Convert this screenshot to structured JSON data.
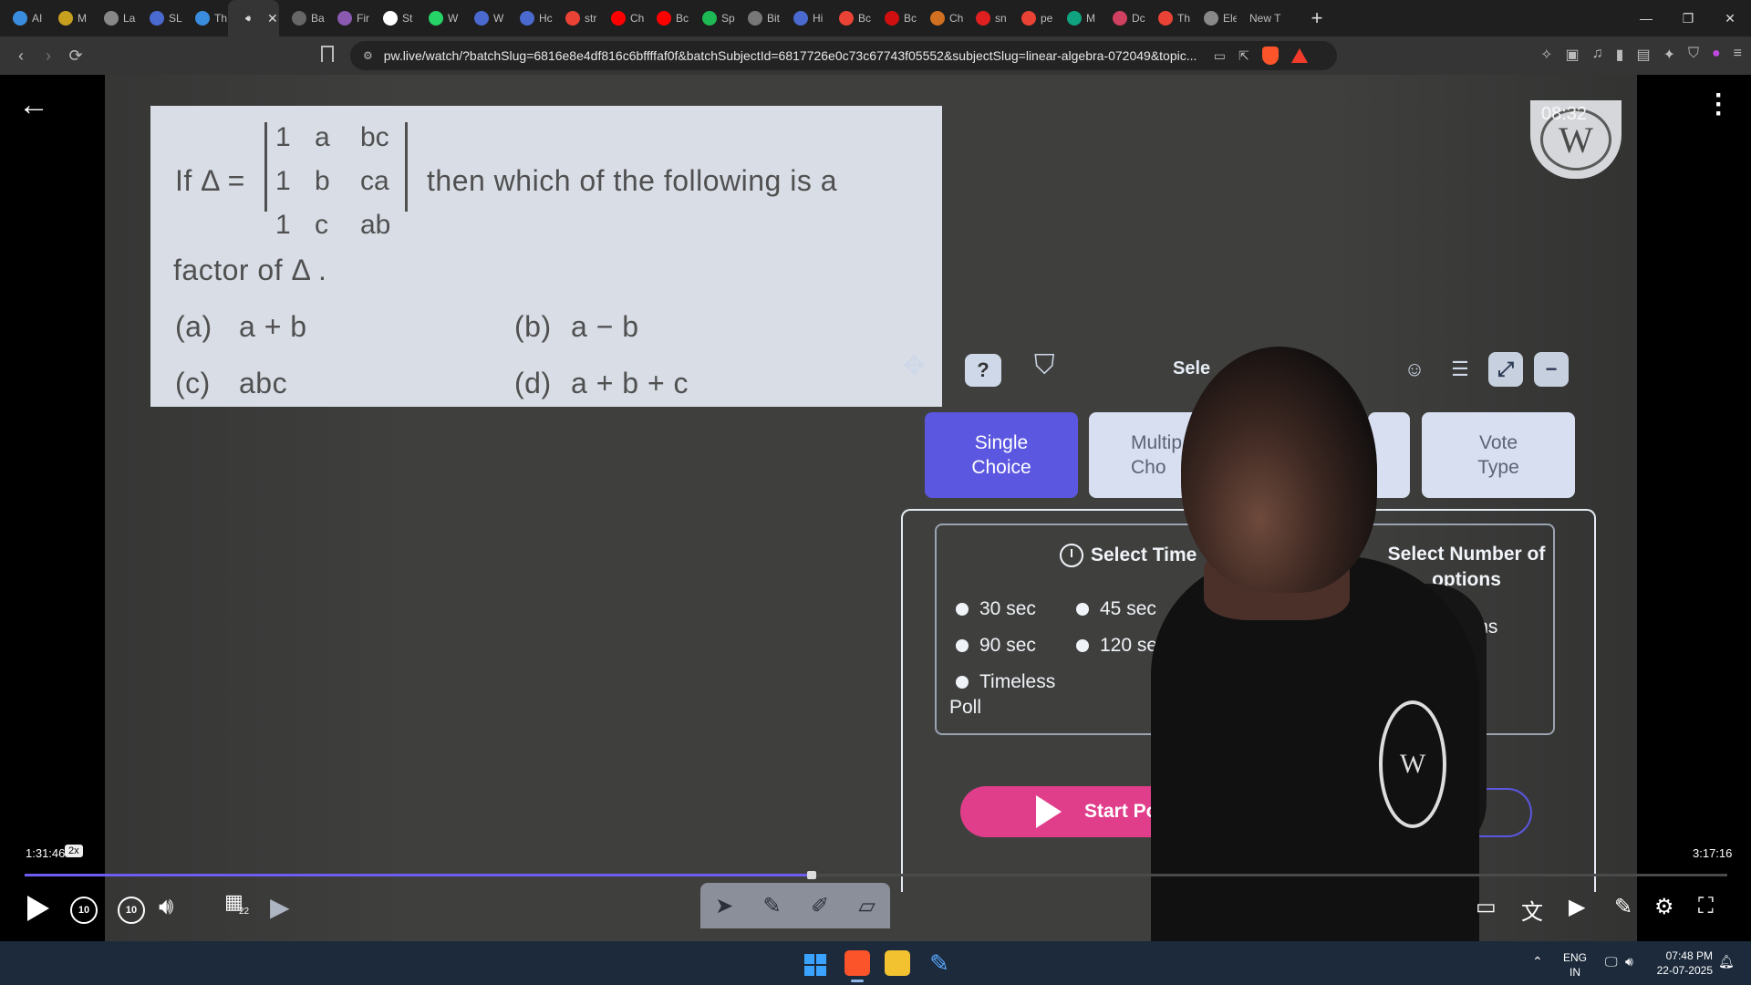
{
  "browser": {
    "tabs": [
      {
        "label": "AI",
        "color": "#3a8dde"
      },
      {
        "label": "M",
        "color": "#c8a020"
      },
      {
        "label": "La",
        "color": "#888888"
      },
      {
        "label": "SL",
        "color": "#4a6ad0"
      },
      {
        "label": "Th",
        "color": "#3a8dde"
      },
      {
        "label": "",
        "color": "#aaaaaa",
        "active": true
      },
      {
        "label": "Ba",
        "color": "#666666"
      },
      {
        "label": "Fir",
        "color": "#8a5ab0"
      },
      {
        "label": "St",
        "color": "#ffffff"
      },
      {
        "label": "W",
        "color": "#25d366"
      },
      {
        "label": "W",
        "color": "#4a6ad0"
      },
      {
        "label": "Hc",
        "color": "#4a6ad0"
      },
      {
        "label": "str",
        "color": "#ea4335"
      },
      {
        "label": "Ch",
        "color": "#ff0000"
      },
      {
        "label": "Bc",
        "color": "#ff0000"
      },
      {
        "label": "Sp",
        "color": "#1db954"
      },
      {
        "label": "Bit",
        "color": "#777777"
      },
      {
        "label": "Hi",
        "color": "#4a6ad0"
      },
      {
        "label": "Bc",
        "color": "#ea4335"
      },
      {
        "label": "Bc",
        "color": "#d01010"
      },
      {
        "label": "Ch",
        "color": "#d07020"
      },
      {
        "label": "sn",
        "color": "#e02020"
      },
      {
        "label": "pe",
        "color": "#ea4335"
      },
      {
        "label": "M",
        "color": "#10a37f"
      },
      {
        "label": "Dc",
        "color": "#d04060"
      },
      {
        "label": "Th",
        "color": "#ea4335"
      },
      {
        "label": "Ele",
        "color": "#888888"
      },
      {
        "label": "New T",
        "color": "",
        "newtab": true
      }
    ],
    "close_x": "✕",
    "new_tab_plus": "+",
    "window_controls": [
      "—",
      "❐",
      "✕"
    ],
    "url": "pw.live/watch/?batchSlug=6816e8e4df816c6bffffaf0f&batchSubjectId=6817726e0c73c67743f05552&subjectSlug=linear-algebra-072049&topic..."
  },
  "question": {
    "prefix": "If  Δ =",
    "det_rows": [
      [
        "1",
        "a",
        "bc"
      ],
      [
        "1",
        "b",
        "ca"
      ],
      [
        "1",
        "c",
        "ab"
      ]
    ],
    "suffix": "then which of the following is a",
    "line2": "factor of  Δ .",
    "options": [
      {
        "label": "(a)",
        "text": "a + b"
      },
      {
        "label": "(b)",
        "text": "a − b"
      },
      {
        "label": "(c)",
        "text": "abc"
      },
      {
        "label": "(d)",
        "text": "a + b + c"
      }
    ]
  },
  "logo": {
    "letters": "W",
    "timestamp": "08:32"
  },
  "poll": {
    "select_label": "Sele",
    "question_icon": "?",
    "types": [
      {
        "line1": "Single",
        "line2": "Choice"
      },
      {
        "line1": "Multip",
        "line2": "Cho"
      },
      {
        "line1": "Vote",
        "line2": "Type"
      }
    ],
    "time_title": "Select Time",
    "times": [
      "30 sec",
      "45 sec",
      "90 sec",
      "120 sec",
      "Timeless"
    ],
    "poll_word": "Poll",
    "num_title": "Select Number of options",
    "option_rows": [
      "Options",
      "ons"
    ],
    "start_label": "Start Po"
  },
  "player": {
    "elapsed": "1:31:46",
    "speed": "2x",
    "duration": "3:17:16",
    "progress_fraction": 0.4624,
    "rewind_label": "10",
    "forward_label": "10",
    "slide_number": "22"
  },
  "taskbar": {
    "lang_line1": "ENG",
    "lang_line2": "IN",
    "clock_time": "07:48 PM",
    "clock_date": "22-07-2025"
  }
}
